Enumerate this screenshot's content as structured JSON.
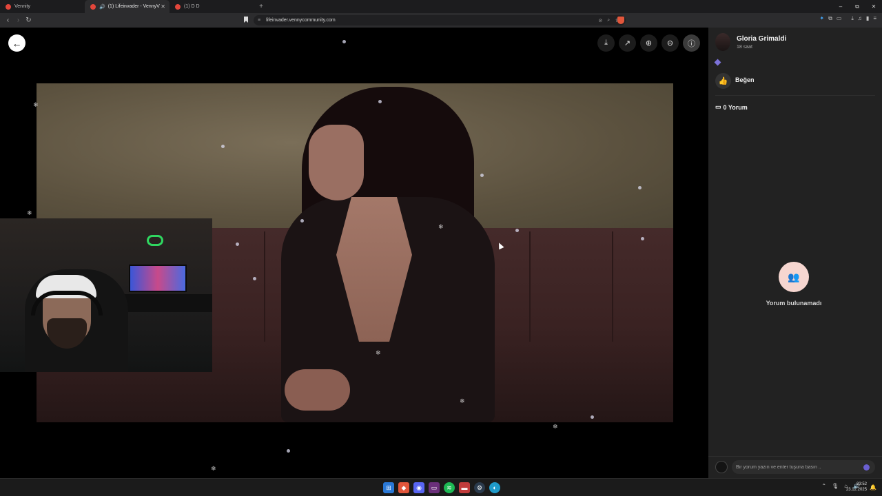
{
  "browser": {
    "tabs": [
      {
        "title": "Vennity",
        "active": false
      },
      {
        "title": "(1) Lifeinvader - VennyV",
        "active": true,
        "audio": true
      },
      {
        "title": "(1) D D",
        "active": false
      }
    ],
    "new_tab": "+",
    "url": "lifeinvader.vennycommunity.com",
    "window_controls": {
      "minimize": "–",
      "restore": "⧉",
      "close": "✕"
    }
  },
  "viewer": {
    "back_icon": "arrow-left-icon",
    "tools": [
      "download-icon",
      "open-external-icon",
      "zoom-in-icon",
      "zoom-out-icon",
      "info-icon"
    ]
  },
  "post": {
    "author": "Gloria Grimaldi",
    "time": "18 saat",
    "like_label": "Beğen",
    "comment_count_label": "0 Yorum",
    "empty_label": "Yorum bulunamadı",
    "comment_placeholder": "Bir yorum yazın ve enter tuşuna basın .."
  },
  "taskbar": {
    "time": "23:52",
    "date": "23.12.2025",
    "apps": [
      "windows-start-icon",
      "brave-icon",
      "discord-icon",
      "app-icon",
      "spotify-icon",
      "app-icon",
      "steam-icon",
      "edge-icon"
    ]
  },
  "colors": {
    "accent": "#7c72d9",
    "panel_bg": "#222222",
    "empty_icon_bg": "#f6d6d0",
    "empty_icon_fg": "#e0554a"
  }
}
